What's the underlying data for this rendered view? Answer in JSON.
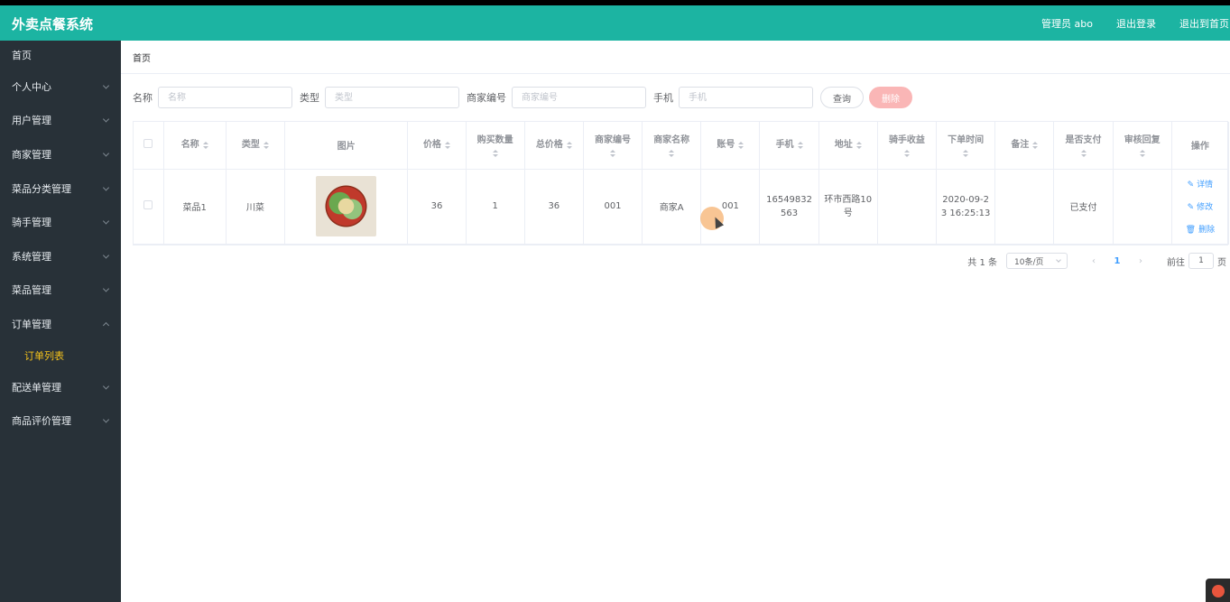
{
  "header": {
    "title": "外卖点餐系统",
    "links": [
      "管理员 abo",
      "退出登录",
      "退出到首页"
    ]
  },
  "sidebar": {
    "items": [
      {
        "label": "首页",
        "expanded": null
      },
      {
        "label": "个人中心",
        "expanded": false
      },
      {
        "label": "用户管理",
        "expanded": false
      },
      {
        "label": "商家管理",
        "expanded": false
      },
      {
        "label": "菜品分类管理",
        "expanded": false
      },
      {
        "label": "骑手管理",
        "expanded": false
      },
      {
        "label": "系统管理",
        "expanded": false
      },
      {
        "label": "菜品管理",
        "expanded": false
      },
      {
        "label": "订单管理",
        "expanded": true
      },
      {
        "label": "配送单管理",
        "expanded": false
      },
      {
        "label": "商品评价管理",
        "expanded": false
      }
    ],
    "submenu": {
      "label": "订单列表",
      "color": "#f5c21b"
    }
  },
  "breadcrumb": "首页",
  "search": {
    "fields": [
      {
        "label": "名称",
        "placeholder": "名称",
        "value": ""
      },
      {
        "label": "类型",
        "placeholder": "类型",
        "value": ""
      },
      {
        "label": "商家编号",
        "placeholder": "商家编号",
        "value": ""
      },
      {
        "label": "手机",
        "placeholder": "手机",
        "value": ""
      }
    ],
    "query_button": "查询",
    "delete_button": "删除"
  },
  "table": {
    "headers": [
      "名称",
      "类型",
      "图片",
      "价格",
      "购买数量",
      "总价格",
      "商家编号",
      "商家名称",
      "账号",
      "手机",
      "地址",
      "骑手收益",
      "下单时间",
      "备注",
      "是否支付",
      "审核回复",
      "操作"
    ],
    "rows": [
      {
        "name": "菜品1",
        "type": "川菜",
        "image": "food-dish-image",
        "price": "36",
        "quantity": "1",
        "total": "36",
        "merchant_no": "001",
        "merchant_name": "商家A",
        "account": "001",
        "phone": "16549832563",
        "address": "环市西路10号",
        "rider_income": "",
        "order_time": "2020-09-23 16:25:13",
        "remark": "",
        "paid": "已支付",
        "review_reply": "",
        "actions": [
          "详情",
          "修改",
          "删除"
        ]
      }
    ]
  },
  "pagination": {
    "total": "共 1 条",
    "page_size": "10条/页",
    "current_page": "1",
    "goto_label": "前往",
    "goto_value": "1",
    "page_suffix": "页"
  },
  "colors": {
    "header": "#1cb4a2",
    "sidebar": "#283138",
    "link": "#409eff",
    "delete_btn": "#fab6b6"
  }
}
